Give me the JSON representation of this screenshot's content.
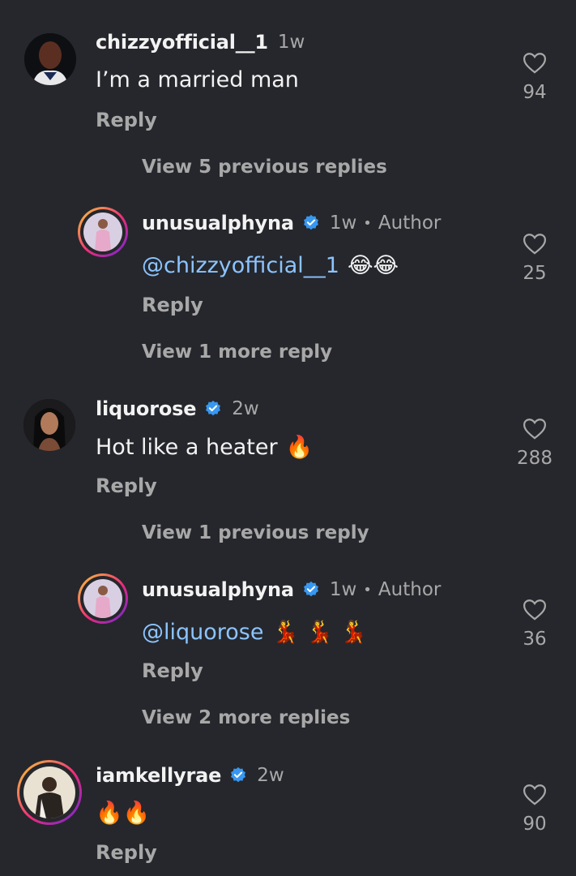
{
  "comments": [
    {
      "username": "chizzyofficial__1",
      "time": "1w",
      "text": "I’m a married man",
      "reply": "Reply",
      "likes": "94",
      "view_replies": "View 5 previous replies"
    },
    {
      "username": "unusualphyna",
      "time": "1w",
      "author": "Author",
      "mention": "@chizzyofficial__1",
      "emoji": "😂😂",
      "reply": "Reply",
      "likes": "25",
      "view_replies": "View 1 more reply"
    },
    {
      "username": "liquorose",
      "time": "2w",
      "text": "Hot like a heater",
      "emoji": "🔥",
      "reply": "Reply",
      "likes": "288",
      "view_replies": "View 1 previous reply"
    },
    {
      "username": "unusualphyna",
      "time": "1w",
      "author": "Author",
      "mention": "@liquorose",
      "emoji": "💃 💃 💃",
      "reply": "Reply",
      "likes": "36",
      "view_replies": "View 2 more replies"
    },
    {
      "username": "iamkellyrae",
      "time": "2w",
      "emoji": "🔥🔥",
      "reply": "Reply",
      "likes": "90"
    }
  ],
  "icons": {
    "like": "heart-outline-icon",
    "verified": "verified-badge-icon",
    "bullet": "•"
  },
  "colors": {
    "background": "#25272c",
    "text": "#f2f2f2",
    "muted": "#a8a8a8",
    "mention": "#8cc4ff",
    "verified": "#3897f0"
  }
}
